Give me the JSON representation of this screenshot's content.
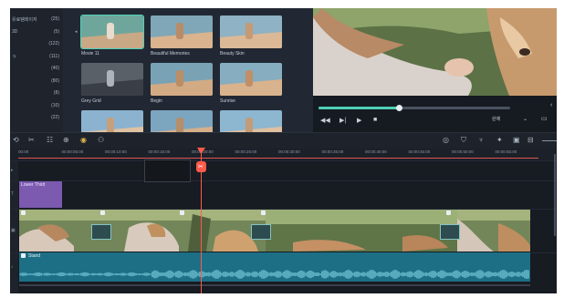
{
  "categories": [
    {
      "label": "유료템레이저",
      "count": "(25)"
    },
    {
      "label": "3D",
      "count": "(5)"
    },
    {
      "label": "",
      "count": "(122)"
    },
    {
      "label": "ㅋ",
      "count": "(111)"
    },
    {
      "label": "",
      "count": "(40)"
    },
    {
      "label": "",
      "count": "(80)"
    },
    {
      "label": "",
      "count": "(8)"
    },
    {
      "label": "",
      "count": "(10)"
    },
    {
      "label": "",
      "count": "(22)"
    }
  ],
  "media": [
    {
      "title": "Movie 11",
      "selected": true
    },
    {
      "title": "Beautiful Memories",
      "selected": false
    },
    {
      "title": "Beauty Skin",
      "selected": false
    },
    {
      "title": "Grey Grid",
      "selected": false
    },
    {
      "title": "Begin",
      "selected": false
    },
    {
      "title": "Sunrise",
      "selected": false
    },
    {
      "title": "",
      "selected": false
    },
    {
      "title": "",
      "selected": false
    },
    {
      "title": "",
      "selected": false
    }
  ],
  "player": {
    "progress": 0.42,
    "quality_label": "완제",
    "controls": [
      "skip-back-icon",
      "step-back-icon",
      "play-icon",
      "stop-icon"
    ]
  },
  "toolbar": {
    "left_icons": [
      "undo-icon",
      "cut-icon",
      "adjust-icon",
      "split-icon",
      "color-icon",
      "speed-icon"
    ],
    "right_icons": [
      "render-icon",
      "shield-icon",
      "mic-icon",
      "magic-icon",
      "caption-icon",
      "marker-icon",
      "zoom-out-icon"
    ]
  },
  "ruler": {
    "ticks": [
      "00:00",
      "00:00:05:00",
      "00:00:10:00",
      "00:00:15:00",
      "00:00:20:00",
      "00:00:25:00",
      "00:00:30:00",
      "00:00:35:00",
      "00:00:40:00",
      "00:00:45:00",
      "00:00:50:00",
      "00:00:55:00"
    ]
  },
  "timeline": {
    "lower_third_label": "Lower Third",
    "audio_label": "Stand",
    "playhead_glyph": "✂"
  },
  "colors": {
    "accent": "#4ed1b8",
    "playhead": "#ff5a4a",
    "lower_third": "#7b5ab0",
    "audio": "#1d6f86",
    "background": "#1b2029"
  }
}
